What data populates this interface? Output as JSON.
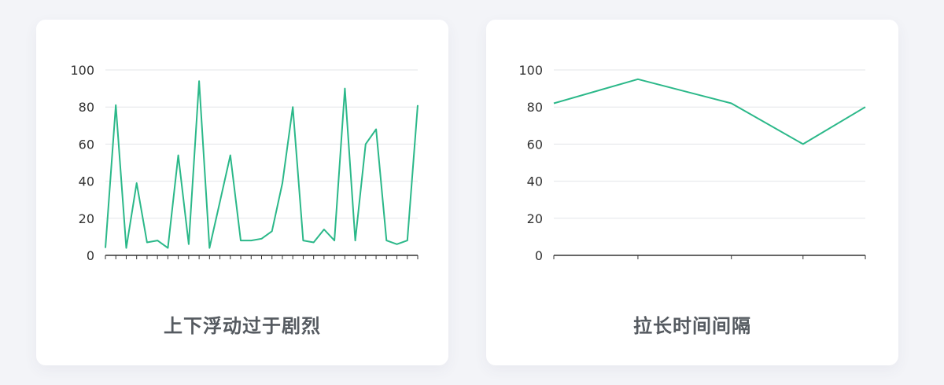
{
  "colors": {
    "series": "#2bb889",
    "grid": "#e3e5e8",
    "axis": "#333333",
    "caption": "#555a60"
  },
  "chart_data": [
    {
      "type": "line",
      "caption": "上下浮动过于剧烈",
      "ylim": [
        0,
        100
      ],
      "yticks": [
        "0",
        "20",
        "40",
        "60",
        "80",
        "100"
      ],
      "grid": true,
      "series": [
        {
          "values": [
            4,
            81,
            4,
            39,
            7,
            8,
            4,
            54,
            6,
            94,
            4,
            29,
            54,
            8,
            8,
            9,
            13,
            39,
            80,
            8,
            7,
            14,
            8,
            90,
            8,
            60,
            68,
            8,
            6,
            8,
            81
          ]
        }
      ]
    },
    {
      "type": "line",
      "caption": "拉长时间间隔",
      "ylim": [
        0,
        100
      ],
      "yticks": [
        "0",
        "20",
        "40",
        "60",
        "80",
        "100"
      ],
      "grid": true,
      "series": [
        {
          "x": [
            0,
            27,
            57,
            80,
            100
          ],
          "values": [
            82,
            95,
            82,
            60,
            80
          ]
        }
      ]
    }
  ]
}
